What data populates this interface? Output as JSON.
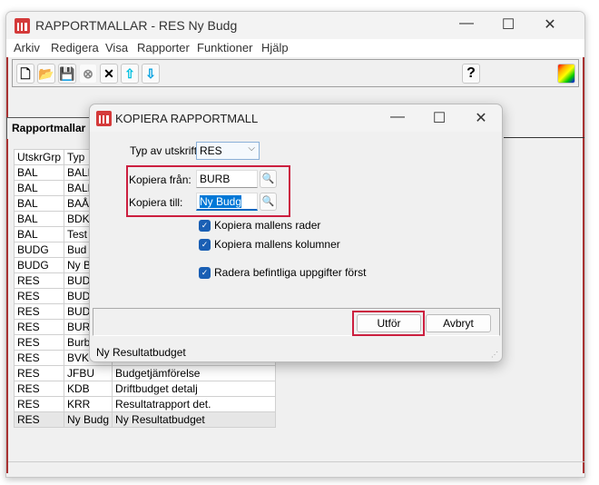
{
  "window": {
    "title": "RAPPORTMALLAR - RES Ny Budg",
    "minimize": "—",
    "maximize": "☐",
    "close": "✕"
  },
  "menu": [
    "Arkiv",
    "Redigera",
    "Visa",
    "Rapporter",
    "Funktioner",
    "Hjälp"
  ],
  "toolbar": {
    "icons": [
      "new-document-icon",
      "open-folder-icon",
      "save-icon",
      "cancel-icon",
      "delete-icon",
      "arrow-up-icon",
      "arrow-down-icon",
      "help-icon",
      "palette-icon"
    ],
    "help_label": "?"
  },
  "tab": "Rapportmallar",
  "table": {
    "headers": [
      "UtskrGrp",
      "Typ",
      ""
    ],
    "rows": [
      [
        "BAL",
        "BALD",
        ""
      ],
      [
        "BAL",
        "BALR",
        ""
      ],
      [
        "BAL",
        "BAÅR",
        ""
      ],
      [
        "BAL",
        "BDKS",
        ""
      ],
      [
        "BAL",
        "Test",
        ""
      ],
      [
        "BUDG",
        "Bud",
        ""
      ],
      [
        "BUDG",
        "Ny BUR",
        ""
      ],
      [
        "RES",
        "BUDB",
        ""
      ],
      [
        "RES",
        "BUDM",
        ""
      ],
      [
        "RES",
        "BUDÖ",
        ""
      ],
      [
        "RES",
        "BURB",
        ""
      ],
      [
        "RES",
        "Burb 1",
        ""
      ],
      [
        "RES",
        "BVK",
        ""
      ],
      [
        "RES",
        "JFBU",
        "Budgetjämförelse"
      ],
      [
        "RES",
        "KDB",
        "Driftbudget detalj"
      ],
      [
        "RES",
        "KRR",
        "Resultatrapport det."
      ],
      [
        "RES",
        "Ny Budg",
        "Ny Resultatbudget"
      ]
    ]
  },
  "dialog": {
    "title": "KOPIERA RAPPORTMALL",
    "typ_label": "Typ av utskrift:",
    "typ_value": "RES",
    "from_label": "Kopiera från:",
    "from_value": "BURB",
    "to_label": "Kopiera till:",
    "to_value": "Ny Budg",
    "checkboxes": [
      {
        "label": "Kopiera mallens rader",
        "checked": true
      },
      {
        "label": "Kopiera mallens kolumner",
        "checked": true
      },
      {
        "label": "Radera befintliga uppgifter först",
        "checked": true
      }
    ],
    "ok": "Utför",
    "cancel": "Avbryt",
    "status": "Ny Resultatbudget"
  },
  "colors": {
    "highlight": "#cc1f3f",
    "checkbox": "#1a5fb4",
    "selection": "#0078d7"
  }
}
